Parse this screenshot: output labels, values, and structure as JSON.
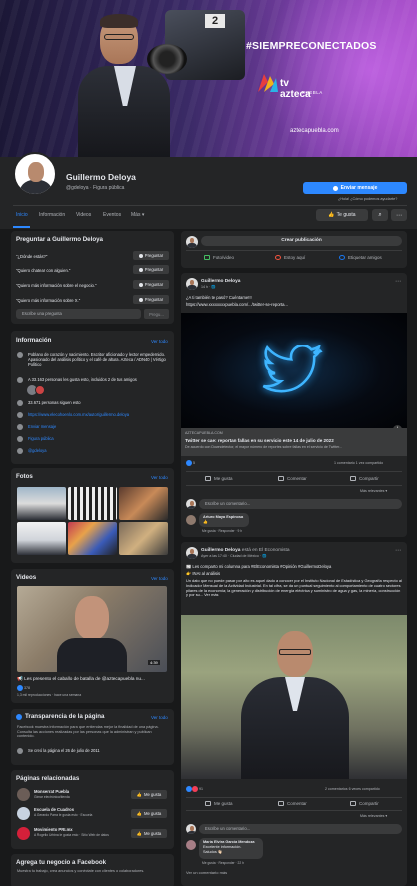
{
  "cover": {
    "hashtag": "#SIEMPRECONECTADOS",
    "brand_tv": "tv azteca",
    "brand_region": "PUEBLA",
    "url": "aztecapuebla.com",
    "camera_number": "2"
  },
  "profile": {
    "name": "Guillermo Deloya",
    "subtitle": "@gdeloya · Figura pública",
    "message_button": "Enviar mensaje",
    "help_text": "¿Hola! ¿Cómo podemos ayudarte?"
  },
  "tabs": [
    "Inicio",
    "Información",
    "Videos",
    "Eventos",
    "Más ▾"
  ],
  "actions": {
    "like": "Te gusta",
    "search_icon": "search-icon",
    "more_icon": "more-icon"
  },
  "ask": {
    "title": "Preguntar a Guillermo Deloya",
    "questions": [
      "\"¿Dónde estás?\"",
      "\"Quiero chatear con alguien.\"",
      "\"Quiero más información sobre el negocio.\"",
      "\"Quiero más información sobre X.\""
    ],
    "button_label": "Preguntar",
    "input_placeholder": "Escribe una pregunta",
    "input_button": "Pregu..."
  },
  "info": {
    "title": "Información",
    "see_all": "Ver todo",
    "bio": "Poblano de corazón y nacimiento. Escritor aficionado y lector empedernido. Apasionado del análisis político y el café de altura. Azteca / ADN40 | Vértigo Político",
    "likes_text": "A 33.163 personas les gusta esto, incluidos 2 de tus amigos",
    "followers_text": "33.671 personas siguen esto",
    "website": "https://www.elecohoenlo.com.mx/autor/guillermo.deloya",
    "send_message": "Enviar mensaje",
    "category": "Figura pública",
    "handle": "@gdeloya"
  },
  "photos": {
    "title": "Fotos",
    "see_all": "Ver todo"
  },
  "videos": {
    "title": "Videos",
    "see_all": "Ver todo",
    "duration": "4:39",
    "caption": "📢 Les presento el caballo de batalla de @aztecapuebla nu...",
    "reactions": "378",
    "meta": "1,3 mil reproducciones · hace una semana"
  },
  "transparency": {
    "title": "Transparencia de la página",
    "see_all": "Ver todo",
    "text": "Facebook muestra información para que entiendas mejor la finalidad de una página. Consulta las acciones realizadas por las personas que la administran y publican contenido.",
    "created": "Se creó la página el 26 de julio de 2011"
  },
  "related": {
    "title": "Páginas relacionadas",
    "items": [
      {
        "name": "Monserrat Puebla",
        "meta": "Gimar electrónica/tienda"
      },
      {
        "name": "Escuela de Cuadros",
        "meta": "A Gerardo Parra le gusta esto · Escuela"
      },
      {
        "name": "Movimiento PRI.mx",
        "meta": "A Rogelio Urbina le gusta esto · Sitio Web de datos"
      }
    ],
    "button": "Me gusta"
  },
  "business": {
    "title": "Agrega tu negocio a Facebook",
    "text": "Muestra tu trabajo, crea anuncios y conéctate con clientes o colaboradores."
  },
  "create_post": {
    "title": "Crear publicación",
    "photo": "Foto/video",
    "here": "Estoy aquí",
    "tag": "Etiquetar amigos"
  },
  "post1": {
    "author": "Guillermo Deloya",
    "meta": "14 h · 🌐",
    "text": "¿A ti también te pasó? Cuéntame!!!",
    "link_text": "https://www.xxxxxxxxpuebla.com/.../twitter-se-reporta...",
    "domain": "AZTECAPUEBLA.COM",
    "headline": "Twitter se cae: reportan fallas en su servicio este 14 de julio de 2022",
    "desc": "De acuerdo con Downdetector, el mayor número de reportes sobre fallas en el servicio de Twitter...",
    "reactions": "5",
    "counts": "1 comentario  1 vez compartido",
    "like": "Me gusta",
    "comment": "Comentar",
    "share": "Compartir",
    "relevant": "Más relevantes ▾",
    "input": "Escribe un comentario...",
    "commenter": "Arturo Maya Espinosa",
    "comment_text": "👍",
    "comment_meta": "Me gusta  ·  Responder  ·  9 h"
  },
  "post2": {
    "author": "Guillermo Deloya",
    "with": "está en El Economista",
    "meta": "Ayer a las 17:40 · Ciudad de México · 🌐",
    "line1": "📰 Les comparto mi columna para #ElEconomista #Opinión #GuillermoDeloya",
    "line2": "👉 INAI al análisis",
    "body": "Un dato que no puede pasar por alto es aquel dado a conocer por el Instituto Nacional de Estadística y Geografía respecto al Indicador Mensual de la Actividad Industrial. En tal cifra, se da un puntual seguimiento al comportamiento de cuatro sectores pilares de la economía; la generación y distribución de energía eléctrica y suministro de agua y gas, la minería, construcción y por su... Ver más",
    "reactions": "91",
    "counts": "2 comentarios  6 veces compartido",
    "like": "Me gusta",
    "comment": "Comentar",
    "share": "Compartir",
    "relevant": "Más relevantes ▾",
    "input": "Escribe un comentario...",
    "commenter": "María Elvira García Mendoza",
    "comment_text": "Excelente información.\nSaludos 👋🏻",
    "comment_meta": "Me gusta  ·  Responder  ·  22 h",
    "more": "Ver un comentario más"
  }
}
